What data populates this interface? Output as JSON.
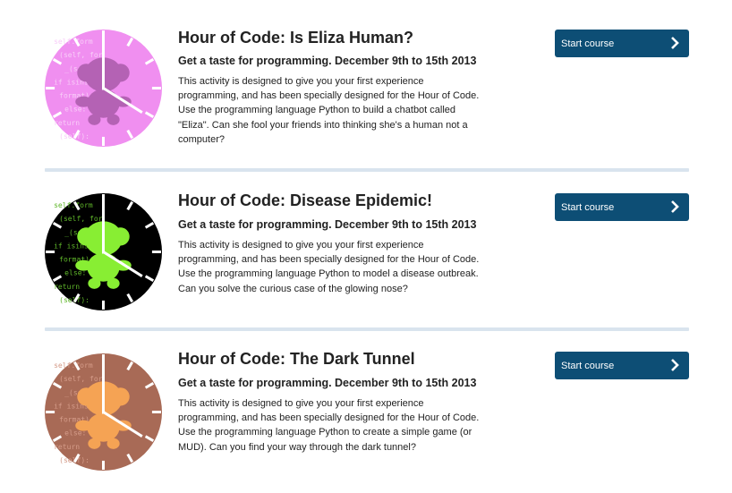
{
  "courses": [
    {
      "title": "Hour of Code: Is Eliza Human?",
      "subtitle": "Get a taste for programming. December 9th to 15th 2013",
      "description_lines": [
        "This activity is designed to give you your first experience",
        "programming, and has been specially designed for the Hour of Code.",
        "Use the programming language Python to build a chatbot called",
        "\"Eliza\". Can she fool your friends into thinking she's a human not a",
        "computer?"
      ],
      "button_label": "Start course",
      "colors": {
        "face": "#f08ff0",
        "monkey": "#b462b4",
        "code": "#f8cdf8"
      }
    },
    {
      "title": "Hour of Code: Disease Epidemic!",
      "subtitle": "Get a taste for programming. December 9th to 15th 2013",
      "description_lines": [
        "This activity is designed to give you your first experience",
        "programming, and has been specially designed for the Hour of Code.",
        "Use the programming language Python to model a disease outbreak.",
        "Can you solve the curious case of the glowing nose?"
      ],
      "button_label": "Start course",
      "colors": {
        "face": "#000000",
        "monkey": "#88ee33",
        "code": "#5fb62a"
      }
    },
    {
      "title": "Hour of Code: The Dark Tunnel",
      "subtitle": "Get a taste for programming. December 9th to 15th 2013",
      "description_lines": [
        "This activity is designed to give you your first experience",
        "programming, and has been specially designed for the Hour of Code.",
        "Use the programming language Python to create a simple game (or",
        "MUD). Can you find your way through the dark tunnel?"
      ],
      "button_label": "Start course",
      "colors": {
        "face": "#a86a56",
        "monkey": "#f5a354",
        "code": "#d49b88"
      }
    }
  ],
  "clock_code_text": [
    "self.form",
    "(self, for",
    "_(self):",
    "if isinst",
    "format) for",
    "else:",
    "return",
    "(self):"
  ],
  "icons": {
    "course_image": "monkey-clock-icon",
    "button": "chevron-right-icon"
  }
}
